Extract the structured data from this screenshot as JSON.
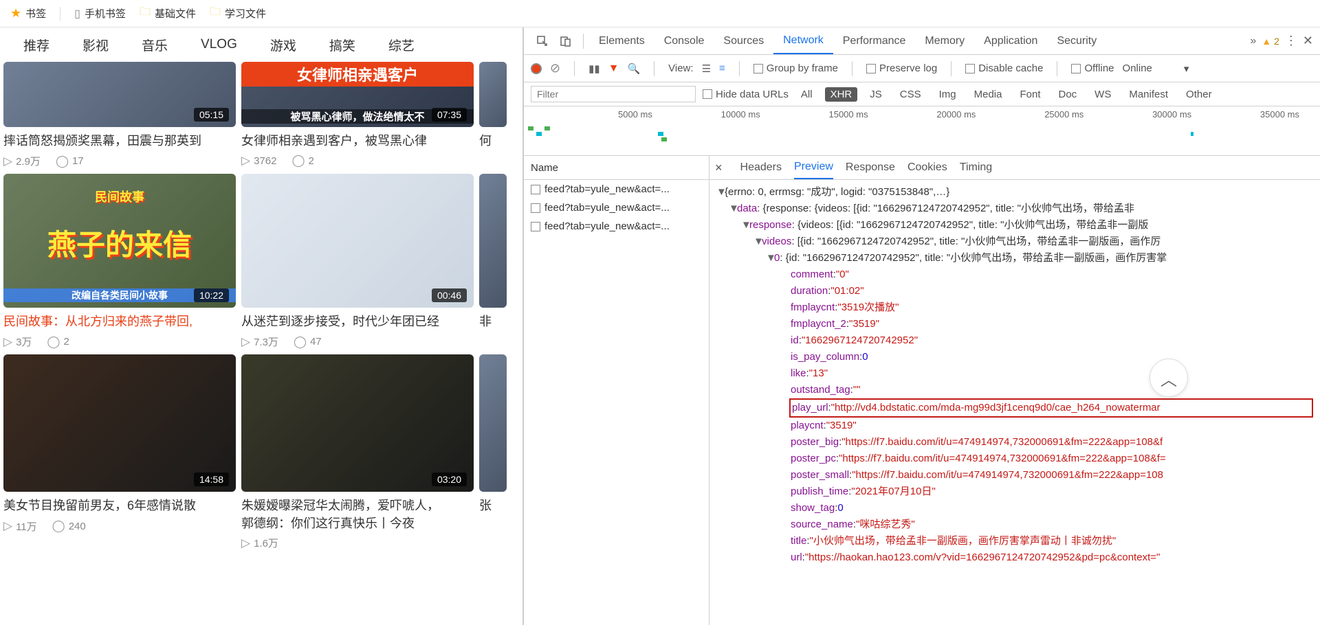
{
  "bookmarks": {
    "main": "书签",
    "mobile": "手机书签",
    "folder1": "基础文件",
    "folder2": "学习文件"
  },
  "categories": [
    "推荐",
    "影视",
    "音乐",
    "VLOG",
    "游戏",
    "搞笑",
    "综艺"
  ],
  "videos": {
    "r1c1": {
      "duration": "05:15",
      "title": "摔话筒怒揭颁奖黑幕，田震与那英到",
      "views": "2.9万",
      "comments": "17",
      "ov": ""
    },
    "r1c2": {
      "duration": "07:35",
      "title": "女律师相亲遇到客户，被骂黑心律",
      "views": "3762",
      "comments": "2",
      "ov1": "女律师相亲遇客户",
      "ov2": "被骂黑心律师，做法绝情太不"
    },
    "r1c3": {
      "title": "何"
    },
    "r2c1": {
      "duration": "10:22",
      "title": "民间故事：从北方归来的燕子带回,",
      "views": "3万",
      "comments": "2",
      "ov1": "民间故事",
      "ov2": "燕子的来信",
      "ov3": "改编自各类民间小故事"
    },
    "r2c2": {
      "duration": "00:46",
      "title": "从迷茫到逐步接受，时代少年团已经",
      "views": "7.3万",
      "comments": "47"
    },
    "r2c3": {
      "title": "非"
    },
    "r3c1": {
      "duration": "14:58",
      "title": "美女节目挽留前男友，6年感情说散",
      "views": "11万",
      "comments": "240"
    },
    "r3c2": {
      "duration": "03:20",
      "title1": "朱媛嫒曝梁冠华太闹腾，爱吓唬人，",
      "title2": "郭德纲：你们这行真快乐丨今夜",
      "views": "1.6万"
    },
    "r3c3": {
      "title": "张"
    }
  },
  "devtools": {
    "tabs": {
      "elements": "Elements",
      "console": "Console",
      "sources": "Sources",
      "network": "Network",
      "performance": "Performance",
      "memory": "Memory",
      "application": "Application",
      "security": "Security"
    },
    "warnings": "2",
    "toolbar": {
      "view": "View:",
      "groupFrame": "Group by frame",
      "preserveLog": "Preserve log",
      "disableCache": "Disable cache",
      "offline": "Offline",
      "online": "Online"
    },
    "filter": {
      "placeholder": "Filter",
      "hideUrls": "Hide data URLs",
      "types": [
        "All",
        "XHR",
        "JS",
        "CSS",
        "Img",
        "Media",
        "Font",
        "Doc",
        "WS",
        "Manifest",
        "Other"
      ]
    },
    "timeline": [
      "5000 ms",
      "10000 ms",
      "15000 ms",
      "20000 ms",
      "25000 ms",
      "30000 ms",
      "35000 ms"
    ],
    "reqList": {
      "header": "Name",
      "items": [
        "feed?tab=yule_new&act=...",
        "feed?tab=yule_new&act=...",
        "feed?tab=yule_new&act=..."
      ]
    },
    "detailTabs": {
      "headers": "Headers",
      "preview": "Preview",
      "response": "Response",
      "cookies": "Cookies",
      "timing": "Timing"
    }
  },
  "json": {
    "root": "{errno: 0, errmsg: \"成功\", logid: \"0375153848\",…}",
    "data": "data",
    "data_v": ": {response: {videos: [{id: \"1662967124720742952\", title: \"小伙帅气出场，带给孟非",
    "response": "response",
    "response_v": ": {videos: [{id: \"1662967124720742952\", title: \"小伙帅气出场，带给孟非一副版",
    "videos": "videos",
    "videos_v": ": [{id: \"1662967124720742952\", title: \"小伙帅气出场，带给孟非一副版画，画作厉",
    "idx0": "0",
    "idx0_v": ": {id: \"1662967124720742952\", title: \"小伙帅气出场，带给孟非一副版画，画作厉害掌",
    "comment_k": "comment",
    "comment_v": "\"0\"",
    "duration_k": "duration",
    "duration_v": "\"01:02\"",
    "fmplaycnt_k": "fmplaycnt",
    "fmplaycnt_v": "\"3519次播放\"",
    "fmplaycnt2_k": "fmplaycnt_2",
    "fmplaycnt2_v": "\"3519\"",
    "id_k": "id",
    "id_v": "\"1662967124720742952\"",
    "ispay_k": "is_pay_column",
    "ispay_v": "0",
    "like_k": "like",
    "like_v": "\"13\"",
    "outstand_k": "outstand_tag",
    "outstand_v": "\"\"",
    "playurl_k": "play_url",
    "playurl_v": "\"http://vd4.bdstatic.com/mda-mg99d3jf1cenq9d0/cae_h264_nowatermar",
    "playcnt_k": "playcnt",
    "playcnt_v": "\"3519\"",
    "posterbig_k": "poster_big",
    "posterbig_v": "\"https://f7.baidu.com/it/u=474914974,732000691&fm=222&app=108&f",
    "posterpc_k": "poster_pc",
    "posterpc_v": "\"https://f7.baidu.com/it/u=474914974,732000691&fm=222&app=108&f=",
    "postersmall_k": "poster_small",
    "postersmall_v": "\"https://f7.baidu.com/it/u=474914974,732000691&fm=222&app=108",
    "pubtime_k": "publish_time",
    "pubtime_v": "\"2021年07月10日\"",
    "showtag_k": "show_tag",
    "showtag_v": "0",
    "srcname_k": "source_name",
    "srcname_v": "\"咪咕综艺秀\"",
    "title_k": "title",
    "title_v": "\"小伙帅气出场，带给孟非一副版画，画作厉害掌声雷动丨非诚勿扰\"",
    "url_k": "url",
    "url_v": "\"https://haokan.hao123.com/v?vid=1662967124720742952&pd=pc&context=\""
  }
}
